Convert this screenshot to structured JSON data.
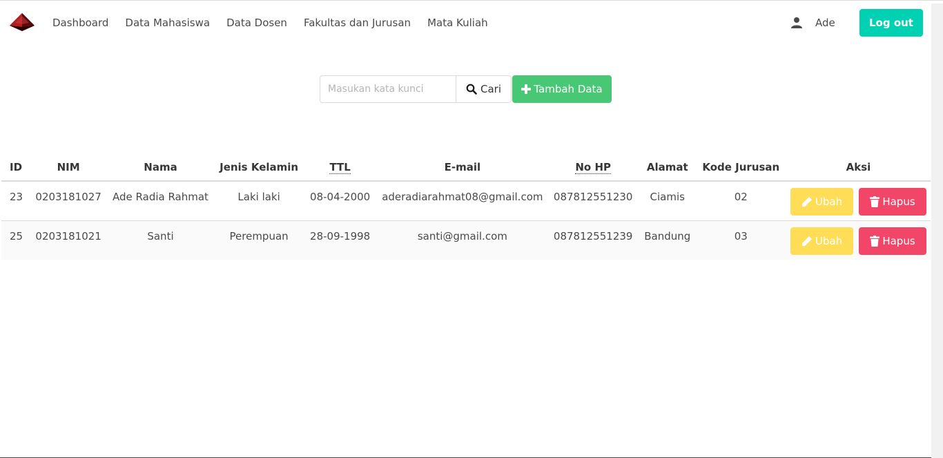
{
  "nav": {
    "brand_icon": "pyramid-logo",
    "links": [
      "Dashboard",
      "Data Mahasiswa",
      "Data Dosen",
      "Fakultas dan Jurusan",
      "Mata Kuliah"
    ],
    "user_icon": "user-icon",
    "user_name": "Ade",
    "logout_label": "Log out"
  },
  "search": {
    "placeholder": "Masukan kata kunci",
    "value": "",
    "button_label": "Cari",
    "add_label": "Tambah Data"
  },
  "table": {
    "headers": [
      "ID",
      "NIM",
      "Nama",
      "Jenis Kelamin",
      "TTL",
      "E-mail",
      "No HP",
      "Alamat",
      "Kode Jurusan",
      "Aksi"
    ],
    "rows": [
      {
        "id": "23",
        "nim": "0203181027",
        "nama": "Ade Radia Rahmat",
        "jk": "Laki laki",
        "ttl": "08-04-2000",
        "email": "aderadiarahmat08@gmail.com",
        "hp": "087812551230",
        "alamat": "Ciamis",
        "kode": "02"
      },
      {
        "id": "25",
        "nim": "0203181021",
        "nama": "Santi",
        "jk": "Perempuan",
        "ttl": "28-09-1998",
        "email": "santi@gmail.com",
        "hp": "087812551239",
        "alamat": "Bandung",
        "kode": "03"
      }
    ],
    "edit_label": "Ubah",
    "delete_label": "Hapus"
  },
  "colors": {
    "primary": "#00d1b2",
    "success": "#48c774",
    "warning": "#ffdd57",
    "danger": "#f14668"
  }
}
